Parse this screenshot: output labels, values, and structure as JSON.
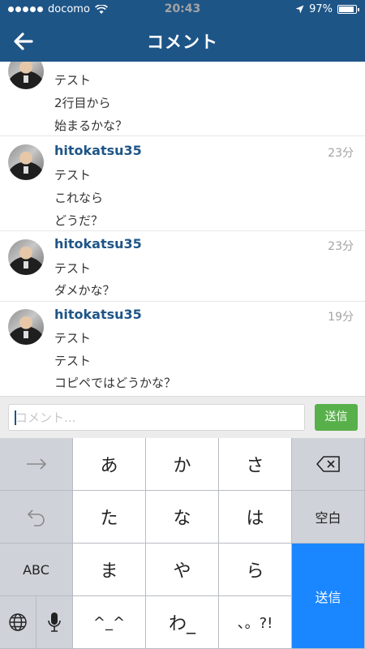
{
  "status": {
    "carrier": "docomo",
    "time": "20:43",
    "battery": "97%",
    "battery_level": 0.97
  },
  "nav": {
    "title": "コメント"
  },
  "comments": [
    {
      "name": "",
      "time": "",
      "lines": [
        "テスト",
        "2行目から",
        "始まるかな？"
      ]
    },
    {
      "name": "hitokatsu35",
      "time": "23分",
      "lines": [
        "テスト",
        "これなら",
        "どうだ？"
      ]
    },
    {
      "name": "hitokatsu35",
      "time": "23分",
      "lines": [
        "テスト",
        "ダメかな？"
      ]
    },
    {
      "name": "hitokatsu35",
      "time": "19分",
      "lines": [
        "テスト",
        "テスト",
        "コピペではどうかな？"
      ]
    }
  ],
  "input": {
    "placeholder": "コメント...",
    "send_label": "送信"
  },
  "keyboard": {
    "row1": [
      "あ",
      "か",
      "さ"
    ],
    "row2": [
      "た",
      "な",
      "は"
    ],
    "row3": [
      "ま",
      "や",
      "ら"
    ],
    "row4": [
      "^_^",
      "わ_",
      "、。?!"
    ],
    "abc": "ABC",
    "space": "空白",
    "return": "送信"
  },
  "colors": {
    "nav": "#1e5587",
    "name": "#1e5587",
    "send": "#58b04a",
    "return_key": "#1a86ff"
  },
  "icons": [
    "back-arrow-icon",
    "wifi-icon",
    "location-icon",
    "battery-icon",
    "delete-icon",
    "undo-icon",
    "globe-icon",
    "microphone-icon",
    "arrow-right-icon"
  ]
}
